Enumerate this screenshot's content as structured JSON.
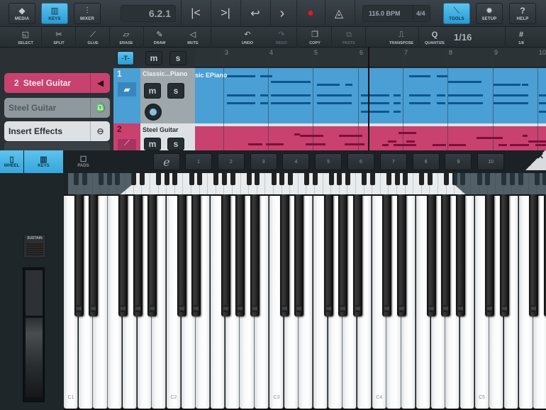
{
  "toolbar": {
    "media": {
      "label": "MEDIA",
      "icon": "◆"
    },
    "keys": {
      "label": "KEYS",
      "icon": "▥",
      "active": true
    },
    "mixer": {
      "label": "MIXER",
      "icon": "⫶"
    },
    "position": "6.2.1",
    "transport": {
      "rewind": "K",
      "forward": "K",
      "loop": "↩",
      "play": "›",
      "record": "●",
      "metronome": "◬"
    },
    "tempo": "116.0 BPM",
    "signature": "4/4",
    "tools": {
      "label": "TOOLS",
      "icon": "⟍",
      "active": true
    },
    "setup": {
      "label": "SETUP",
      "icon": "✹"
    },
    "help": {
      "label": "HELP",
      "icon": "?"
    }
  },
  "tools_row": [
    {
      "label": "SELECT",
      "icon": "◱",
      "enabled": true
    },
    {
      "label": "SPLIT",
      "icon": "✂",
      "enabled": true
    },
    {
      "label": "GLUE",
      "icon": "⟋",
      "enabled": true
    },
    {
      "label": "ERASE",
      "icon": "▱",
      "enabled": true
    },
    {
      "label": "DRAW",
      "icon": "✎",
      "enabled": true
    },
    {
      "label": "MUTE",
      "icon": "◁",
      "enabled": true
    },
    {
      "label": "UNDO",
      "icon": "↶",
      "enabled": true
    },
    {
      "label": "REDO",
      "icon": "↷",
      "enabled": false
    },
    {
      "label": "COPY",
      "icon": "❐",
      "enabled": true
    },
    {
      "label": "PASTE",
      "icon": "⧉",
      "enabled": false
    },
    {
      "label": "TRANSPOSE",
      "icon": "⎍",
      "enabled": true
    },
    {
      "label": "QUANTIZE",
      "icon": "Q",
      "enabled": true
    },
    {
      "label": "1/8",
      "icon": "#",
      "enabled": true
    }
  ],
  "quantize_value": "1/16",
  "inspector": {
    "track_number": "2",
    "track_name": "Steel Guitar",
    "instrument": "Steel Guitar",
    "insert_effects": "Insert Effects"
  },
  "track_header_tools": {
    "mute": "m",
    "solo": "s"
  },
  "ruler": {
    "bars": [
      "3",
      "4",
      "5",
      "6",
      "7",
      "8",
      "9",
      "10"
    ]
  },
  "tracks": [
    {
      "number": "1",
      "name": "Classic...Piano",
      "clip_name": "sic EPiano",
      "color": "#4a9fd4",
      "note_color": "#0c5790",
      "mute": "m",
      "solo": "s"
    },
    {
      "number": "2",
      "name": "Steel Guitar",
      "color": "#c9416f",
      "note_color": "#7d0f3a",
      "mute": "m",
      "solo": "s"
    }
  ],
  "instrument_panel": {
    "tabs": [
      {
        "label": "WHEEL",
        "icon": "▯",
        "active": true
      },
      {
        "label": "KEYS",
        "icon": "▥",
        "active": true
      },
      {
        "label": "PADS",
        "icon": "☐",
        "active": false
      }
    ],
    "preset_logo": "e",
    "presets": [
      "1",
      "2",
      "3",
      "4",
      "5",
      "6",
      "7",
      "8",
      "9",
      "10"
    ],
    "close": "✕",
    "sustain_label": "SUSTAIN"
  },
  "keyboard": {
    "octave_labels": [
      "C1",
      "C2",
      "C3",
      "C4",
      "C5"
    ]
  }
}
